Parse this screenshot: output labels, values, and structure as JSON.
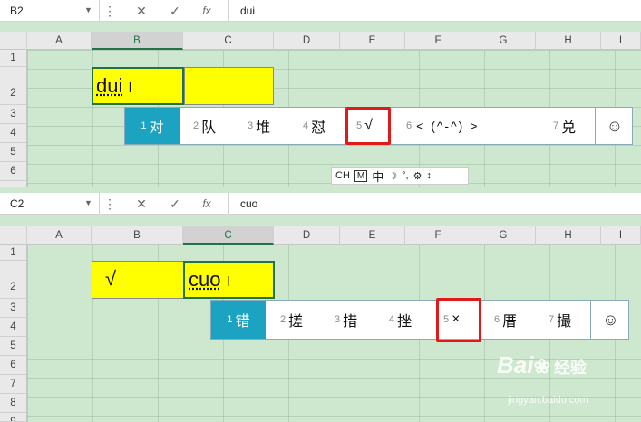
{
  "top": {
    "name_box": "B2",
    "formula_value": "dui",
    "columns": [
      "A",
      "B",
      "C",
      "D",
      "E",
      "F",
      "G",
      "H",
      "I"
    ],
    "rows": [
      "1",
      "2",
      "3",
      "4",
      "5",
      "6"
    ],
    "cell_b2": "dui",
    "ime_candidates": [
      {
        "n": "1",
        "t": "对"
      },
      {
        "n": "2",
        "t": "队"
      },
      {
        "n": "3",
        "t": "堆"
      },
      {
        "n": "4",
        "t": "怼"
      },
      {
        "n": "5",
        "t": "√"
      },
      {
        "n": "6",
        "t": "< (^-^) >"
      },
      {
        "n": "7",
        "t": "兑"
      }
    ]
  },
  "ime_toolbar": {
    "items": [
      "CH",
      "M",
      "中",
      "☽",
      "°,",
      "⚙",
      "↕"
    ]
  },
  "bottom": {
    "name_box": "C2",
    "formula_value": "cuo",
    "columns": [
      "A",
      "B",
      "C",
      "D",
      "E",
      "F",
      "G",
      "H",
      "I"
    ],
    "rows": [
      "1",
      "2",
      "3",
      "4",
      "5",
      "6",
      "7",
      "8",
      "9"
    ],
    "cell_b2": "√",
    "cell_c2": "cuo",
    "ime_candidates": [
      {
        "n": "1",
        "t": "错"
      },
      {
        "n": "2",
        "t": "搓"
      },
      {
        "n": "3",
        "t": "措"
      },
      {
        "n": "4",
        "t": "挫"
      },
      {
        "n": "5",
        "t": "×"
      },
      {
        "n": "6",
        "t": "厝"
      },
      {
        "n": "7",
        "t": "撮"
      }
    ]
  },
  "icons": {
    "cancel": "✕",
    "confirm": "✓",
    "fx": "fx",
    "smile": "☺",
    "name_caret": "▼",
    "more": "⋮"
  },
  "watermark": {
    "brand": "Bai",
    "brand2": "经验",
    "url": "jingyan.baidu.com"
  }
}
